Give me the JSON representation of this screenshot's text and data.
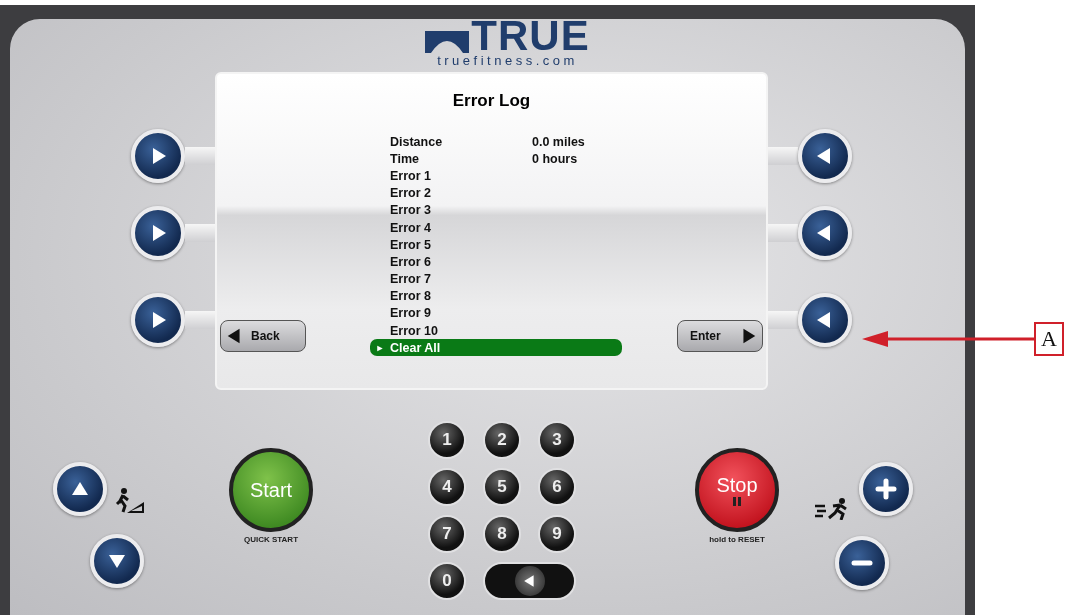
{
  "logo": {
    "brand": "TRUE",
    "url": "truefitness.com"
  },
  "screen": {
    "title": "Error Log",
    "items": [
      {
        "label": "Distance",
        "value": "0.0 miles",
        "selected": false
      },
      {
        "label": "Time",
        "value": "0 hours",
        "selected": false
      },
      {
        "label": "Error 1",
        "selected": false
      },
      {
        "label": "Error 2",
        "selected": false
      },
      {
        "label": "Error 3",
        "selected": false
      },
      {
        "label": "Error 4",
        "selected": false
      },
      {
        "label": "Error 5",
        "selected": false
      },
      {
        "label": "Error 6",
        "selected": false
      },
      {
        "label": "Error 7",
        "selected": false
      },
      {
        "label": "Error 8",
        "selected": false
      },
      {
        "label": "Error 9",
        "selected": false
      },
      {
        "label": "Error 10",
        "selected": false
      },
      {
        "label": "Clear All",
        "marker": "►",
        "selected": true
      }
    ],
    "back_button": {
      "label": "Back"
    },
    "enter_button": {
      "label": "Enter"
    }
  },
  "start_button": {
    "label": "Start",
    "caption": "QUICK START"
  },
  "keypad": {
    "keys": [
      "1",
      "2",
      "3",
      "4",
      "5",
      "6",
      "7",
      "8",
      "9",
      "0"
    ]
  },
  "stop_button": {
    "label": "Stop",
    "caption": "hold to RESET"
  },
  "callout": {
    "label": "A"
  }
}
